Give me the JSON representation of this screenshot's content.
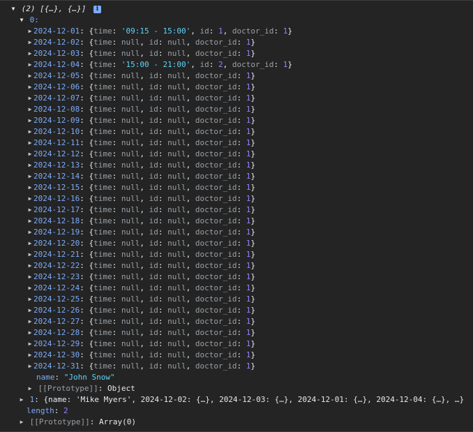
{
  "summary": {
    "count": "(2)",
    "preview": "[{…}, {…}]",
    "info": "i"
  },
  "item0": {
    "label": "0:"
  },
  "dates": [
    {
      "date": "2024-12-01",
      "time": "'09:15 - 15:00'",
      "id": "1",
      "doctor_id": "1"
    },
    {
      "date": "2024-12-02",
      "time": "null",
      "id": "null",
      "doctor_id": "1"
    },
    {
      "date": "2024-12-03",
      "time": "null",
      "id": "null",
      "doctor_id": "1"
    },
    {
      "date": "2024-12-04",
      "time": "'15:00 - 21:00'",
      "id": "2",
      "doctor_id": "1"
    },
    {
      "date": "2024-12-05",
      "time": "null",
      "id": "null",
      "doctor_id": "1"
    },
    {
      "date": "2024-12-06",
      "time": "null",
      "id": "null",
      "doctor_id": "1"
    },
    {
      "date": "2024-12-07",
      "time": "null",
      "id": "null",
      "doctor_id": "1"
    },
    {
      "date": "2024-12-08",
      "time": "null",
      "id": "null",
      "doctor_id": "1"
    },
    {
      "date": "2024-12-09",
      "time": "null",
      "id": "null",
      "doctor_id": "1"
    },
    {
      "date": "2024-12-10",
      "time": "null",
      "id": "null",
      "doctor_id": "1"
    },
    {
      "date": "2024-12-11",
      "time": "null",
      "id": "null",
      "doctor_id": "1"
    },
    {
      "date": "2024-12-12",
      "time": "null",
      "id": "null",
      "doctor_id": "1"
    },
    {
      "date": "2024-12-13",
      "time": "null",
      "id": "null",
      "doctor_id": "1"
    },
    {
      "date": "2024-12-14",
      "time": "null",
      "id": "null",
      "doctor_id": "1"
    },
    {
      "date": "2024-12-15",
      "time": "null",
      "id": "null",
      "doctor_id": "1"
    },
    {
      "date": "2024-12-16",
      "time": "null",
      "id": "null",
      "doctor_id": "1"
    },
    {
      "date": "2024-12-17",
      "time": "null",
      "id": "null",
      "doctor_id": "1"
    },
    {
      "date": "2024-12-18",
      "time": "null",
      "id": "null",
      "doctor_id": "1"
    },
    {
      "date": "2024-12-19",
      "time": "null",
      "id": "null",
      "doctor_id": "1"
    },
    {
      "date": "2024-12-20",
      "time": "null",
      "id": "null",
      "doctor_id": "1"
    },
    {
      "date": "2024-12-21",
      "time": "null",
      "id": "null",
      "doctor_id": "1"
    },
    {
      "date": "2024-12-22",
      "time": "null",
      "id": "null",
      "doctor_id": "1"
    },
    {
      "date": "2024-12-23",
      "time": "null",
      "id": "null",
      "doctor_id": "1"
    },
    {
      "date": "2024-12-24",
      "time": "null",
      "id": "null",
      "doctor_id": "1"
    },
    {
      "date": "2024-12-25",
      "time": "null",
      "id": "null",
      "doctor_id": "1"
    },
    {
      "date": "2024-12-26",
      "time": "null",
      "id": "null",
      "doctor_id": "1"
    },
    {
      "date": "2024-12-27",
      "time": "null",
      "id": "null",
      "doctor_id": "1"
    },
    {
      "date": "2024-12-28",
      "time": "null",
      "id": "null",
      "doctor_id": "1"
    },
    {
      "date": "2024-12-29",
      "time": "null",
      "id": "null",
      "doctor_id": "1"
    },
    {
      "date": "2024-12-30",
      "time": "null",
      "id": "null",
      "doctor_id": "1"
    },
    {
      "date": "2024-12-31",
      "time": "null",
      "id": "null",
      "doctor_id": "1"
    }
  ],
  "name_row": {
    "key": "name",
    "value": "\"John Snow\""
  },
  "proto0": {
    "key": "[[Prototype]]",
    "value": "Object"
  },
  "item1": {
    "index": "1",
    "text": "{name: 'Mike Myers', 2024-12-02: {…}, 2024-12-03: {…}, 2024-12-01: {…}, 2024-12-04: {…}, …}"
  },
  "length_row": {
    "key": "length",
    "value": "2"
  },
  "proto_root": {
    "key": "[[Prototype]]",
    "value": "Array(0)"
  },
  "colors": {
    "background": "#242424",
    "key": "#7cacf8",
    "string": "#5cd5fb",
    "number": "#9980ff",
    "null": "#9aa0a6"
  }
}
